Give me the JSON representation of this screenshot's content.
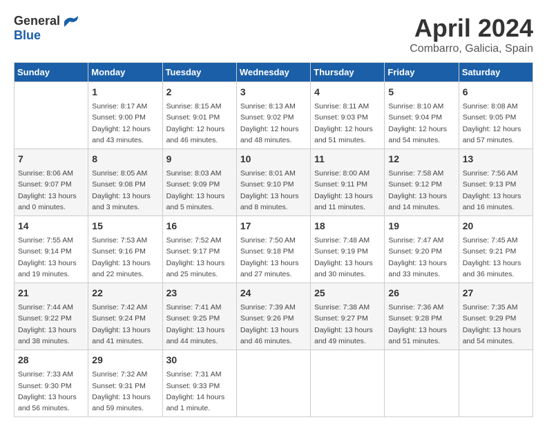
{
  "header": {
    "logo": {
      "general": "General",
      "blue": "Blue"
    },
    "title": "April 2024",
    "location": "Combarro, Galicia, Spain"
  },
  "calendar": {
    "days_of_week": [
      "Sunday",
      "Monday",
      "Tuesday",
      "Wednesday",
      "Thursday",
      "Friday",
      "Saturday"
    ],
    "weeks": [
      [
        {
          "day": "",
          "info": ""
        },
        {
          "day": "1",
          "info": "Sunrise: 8:17 AM\nSunset: 9:00 PM\nDaylight: 12 hours\nand 43 minutes."
        },
        {
          "day": "2",
          "info": "Sunrise: 8:15 AM\nSunset: 9:01 PM\nDaylight: 12 hours\nand 46 minutes."
        },
        {
          "day": "3",
          "info": "Sunrise: 8:13 AM\nSunset: 9:02 PM\nDaylight: 12 hours\nand 48 minutes."
        },
        {
          "day": "4",
          "info": "Sunrise: 8:11 AM\nSunset: 9:03 PM\nDaylight: 12 hours\nand 51 minutes."
        },
        {
          "day": "5",
          "info": "Sunrise: 8:10 AM\nSunset: 9:04 PM\nDaylight: 12 hours\nand 54 minutes."
        },
        {
          "day": "6",
          "info": "Sunrise: 8:08 AM\nSunset: 9:05 PM\nDaylight: 12 hours\nand 57 minutes."
        }
      ],
      [
        {
          "day": "7",
          "info": "Sunrise: 8:06 AM\nSunset: 9:07 PM\nDaylight: 13 hours\nand 0 minutes."
        },
        {
          "day": "8",
          "info": "Sunrise: 8:05 AM\nSunset: 9:08 PM\nDaylight: 13 hours\nand 3 minutes."
        },
        {
          "day": "9",
          "info": "Sunrise: 8:03 AM\nSunset: 9:09 PM\nDaylight: 13 hours\nand 5 minutes."
        },
        {
          "day": "10",
          "info": "Sunrise: 8:01 AM\nSunset: 9:10 PM\nDaylight: 13 hours\nand 8 minutes."
        },
        {
          "day": "11",
          "info": "Sunrise: 8:00 AM\nSunset: 9:11 PM\nDaylight: 13 hours\nand 11 minutes."
        },
        {
          "day": "12",
          "info": "Sunrise: 7:58 AM\nSunset: 9:12 PM\nDaylight: 13 hours\nand 14 minutes."
        },
        {
          "day": "13",
          "info": "Sunrise: 7:56 AM\nSunset: 9:13 PM\nDaylight: 13 hours\nand 16 minutes."
        }
      ],
      [
        {
          "day": "14",
          "info": "Sunrise: 7:55 AM\nSunset: 9:14 PM\nDaylight: 13 hours\nand 19 minutes."
        },
        {
          "day": "15",
          "info": "Sunrise: 7:53 AM\nSunset: 9:16 PM\nDaylight: 13 hours\nand 22 minutes."
        },
        {
          "day": "16",
          "info": "Sunrise: 7:52 AM\nSunset: 9:17 PM\nDaylight: 13 hours\nand 25 minutes."
        },
        {
          "day": "17",
          "info": "Sunrise: 7:50 AM\nSunset: 9:18 PM\nDaylight: 13 hours\nand 27 minutes."
        },
        {
          "day": "18",
          "info": "Sunrise: 7:48 AM\nSunset: 9:19 PM\nDaylight: 13 hours\nand 30 minutes."
        },
        {
          "day": "19",
          "info": "Sunrise: 7:47 AM\nSunset: 9:20 PM\nDaylight: 13 hours\nand 33 minutes."
        },
        {
          "day": "20",
          "info": "Sunrise: 7:45 AM\nSunset: 9:21 PM\nDaylight: 13 hours\nand 36 minutes."
        }
      ],
      [
        {
          "day": "21",
          "info": "Sunrise: 7:44 AM\nSunset: 9:22 PM\nDaylight: 13 hours\nand 38 minutes."
        },
        {
          "day": "22",
          "info": "Sunrise: 7:42 AM\nSunset: 9:24 PM\nDaylight: 13 hours\nand 41 minutes."
        },
        {
          "day": "23",
          "info": "Sunrise: 7:41 AM\nSunset: 9:25 PM\nDaylight: 13 hours\nand 44 minutes."
        },
        {
          "day": "24",
          "info": "Sunrise: 7:39 AM\nSunset: 9:26 PM\nDaylight: 13 hours\nand 46 minutes."
        },
        {
          "day": "25",
          "info": "Sunrise: 7:38 AM\nSunset: 9:27 PM\nDaylight: 13 hours\nand 49 minutes."
        },
        {
          "day": "26",
          "info": "Sunrise: 7:36 AM\nSunset: 9:28 PM\nDaylight: 13 hours\nand 51 minutes."
        },
        {
          "day": "27",
          "info": "Sunrise: 7:35 AM\nSunset: 9:29 PM\nDaylight: 13 hours\nand 54 minutes."
        }
      ],
      [
        {
          "day": "28",
          "info": "Sunrise: 7:33 AM\nSunset: 9:30 PM\nDaylight: 13 hours\nand 56 minutes."
        },
        {
          "day": "29",
          "info": "Sunrise: 7:32 AM\nSunset: 9:31 PM\nDaylight: 13 hours\nand 59 minutes."
        },
        {
          "day": "30",
          "info": "Sunrise: 7:31 AM\nSunset: 9:33 PM\nDaylight: 14 hours\nand 1 minute."
        },
        {
          "day": "",
          "info": ""
        },
        {
          "day": "",
          "info": ""
        },
        {
          "day": "",
          "info": ""
        },
        {
          "day": "",
          "info": ""
        }
      ]
    ]
  }
}
